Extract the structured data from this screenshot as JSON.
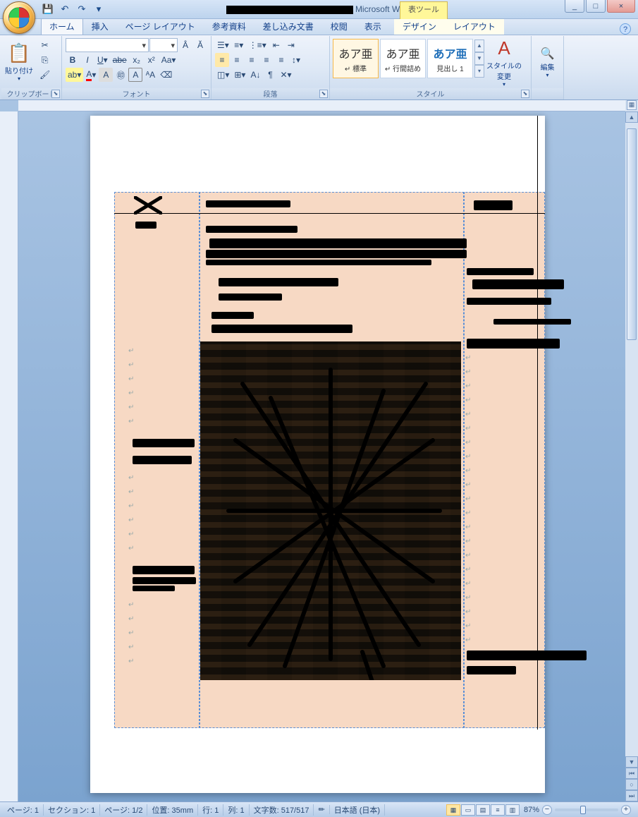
{
  "app": {
    "name": "Microsoft Word",
    "title_redacted": true
  },
  "contextual_tab": {
    "label": "表ツール"
  },
  "window_controls": {
    "minimize": "_",
    "maximize": "□",
    "close": "×"
  },
  "qat": {
    "save": "save-icon",
    "undo": "↶",
    "redo": "↷",
    "customize": "▾"
  },
  "tabs": {
    "items": [
      "ホーム",
      "挿入",
      "ページ レイアウト",
      "参考資料",
      "差し込み文書",
      "校閲",
      "表示"
    ],
    "context_items": [
      "デザイン",
      "レイアウト"
    ],
    "active_index": 0
  },
  "ribbon": {
    "groups": {
      "clipboard": {
        "label": "クリップボード",
        "paste": "貼り付け",
        "cut": "cut-icon",
        "copy": "copy-icon",
        "format_painter": "format-painter-icon"
      },
      "font": {
        "label": "フォント",
        "font_name_value": "",
        "font_size_value": ""
      },
      "paragraph": {
        "label": "段落"
      },
      "styles": {
        "label": "スタイル",
        "items": [
          {
            "sample": "あア亜",
            "name": "↵ 標準"
          },
          {
            "sample": "あア亜",
            "name": "↵ 行間詰め"
          },
          {
            "sample": "あア亜",
            "name": "見出し 1"
          }
        ],
        "change_styles": "スタイルの変更"
      },
      "editing": {
        "label": "編集"
      }
    }
  },
  "help": "?",
  "document": {
    "has_table": true,
    "table_bg": "#f7d9c4",
    "content_redacted": true
  },
  "status": {
    "page": "ページ: 1",
    "section": "セクション: 1",
    "page_of": "ページ: 1/2",
    "position": "位置: 35mm",
    "line": "行: 1",
    "column": "列: 1",
    "chars": "文字数: 517/517",
    "language": "日本語 (日本)",
    "zoom_value": "87%"
  }
}
